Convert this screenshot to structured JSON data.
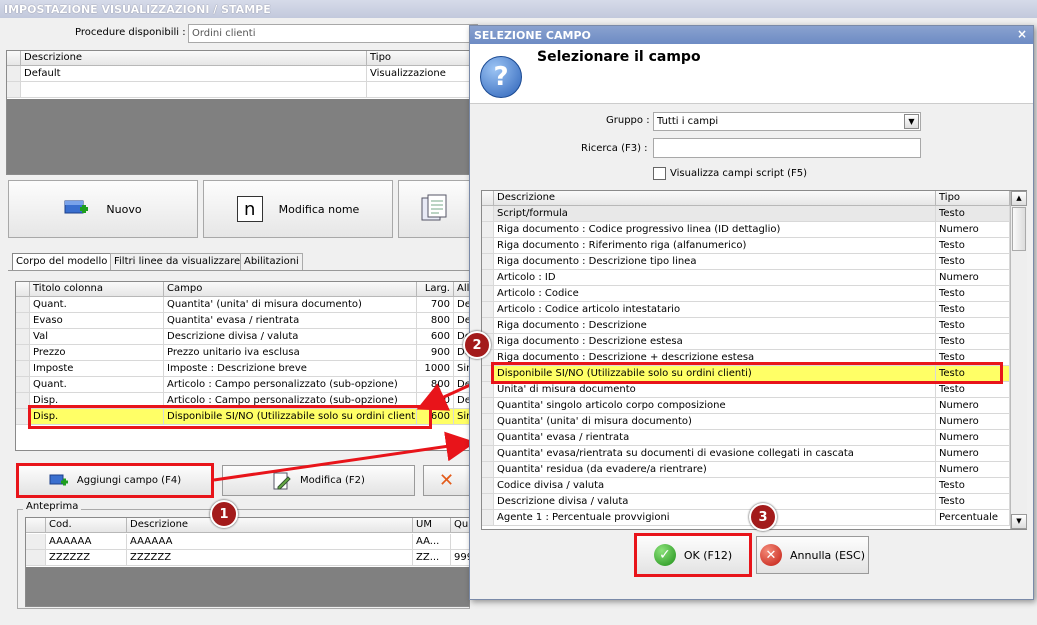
{
  "main": {
    "title": "IMPOSTAZIONE VISUALIZZAZIONI / STAMPE",
    "procedure_label": "Procedure disponibili :",
    "procedure_value": "Ordini clienti",
    "procedures_table": {
      "headers": [
        "Descrizione",
        "Tipo"
      ],
      "rows": [
        [
          "Default",
          "Visualizzazione"
        ]
      ]
    },
    "buttons": {
      "nuovo": "Nuovo",
      "modifica_nome": "Modifica nome",
      "n_glyph": "n"
    },
    "tabs": [
      "Corpo del modello",
      "Filtri linee da visualizzare",
      "Abilitazioni"
    ],
    "columns_table": {
      "headers": [
        "Titolo colonna",
        "Campo",
        "Larg.",
        "All"
      ],
      "rows": [
        [
          "Quant.",
          "Quantita' (unita' di misura documento)",
          "700",
          "De"
        ],
        [
          "Evaso",
          "Quantita' evasa / rientrata",
          "800",
          "De"
        ],
        [
          "Val",
          "Descrizione divisa / valuta",
          "600",
          "De"
        ],
        [
          "Prezzo",
          "Prezzo unitario iva esclusa",
          "900",
          "De"
        ],
        [
          "Imposte",
          "Imposte : Descrizione breve",
          "1000",
          "Sin"
        ],
        [
          "Quant.",
          "Articolo : Campo personalizzato (sub-opzione)",
          "800",
          "De"
        ],
        [
          "Disp.",
          "Articolo : Campo personalizzato (sub-opzione)",
          "800",
          "De"
        ],
        [
          "Disp.",
          "Disponibile SI/NO (Utilizzabile solo su ordini clienti)",
          "600",
          "Sin"
        ]
      ]
    },
    "actions": {
      "aggiungi": "Aggiungi campo (F4)",
      "modifica": "Modifica (F2)"
    },
    "anteprima": {
      "label": "Anteprima",
      "headers": [
        "Cod.",
        "Descrizione",
        "UM",
        "Qu"
      ],
      "rows": [
        [
          "AAAAAA",
          "AAAAAA",
          "AA...",
          ""
        ],
        [
          "ZZZZZZ",
          "ZZZZZZ",
          "ZZ...",
          "999"
        ]
      ]
    }
  },
  "dialog": {
    "title": "SELEZIONE CAMPO",
    "close": "×",
    "heading": "Selezionare il campo",
    "gruppo_label": "Gruppo :",
    "gruppo_value": "Tutti i campi",
    "ricerca_label": "Ricerca (F3) :",
    "ricerca_value": "",
    "script_checkbox": "Visualizza campi script (F5)",
    "table": {
      "headers": [
        "Descrizione",
        "Tipo"
      ],
      "rows": [
        [
          "Script/formula",
          "Testo"
        ],
        [
          "Riga documento : Codice progressivo linea (ID dettaglio)",
          "Numero"
        ],
        [
          "Riga documento : Riferimento riga (alfanumerico)",
          "Testo"
        ],
        [
          "Riga documento : Descrizione tipo linea",
          "Testo"
        ],
        [
          "Articolo : ID",
          "Numero"
        ],
        [
          "Articolo : Codice",
          "Testo"
        ],
        [
          "Articolo : Codice articolo intestatario",
          "Testo"
        ],
        [
          "Riga documento : Descrizione",
          "Testo"
        ],
        [
          "Riga documento : Descrizione estesa",
          "Testo"
        ],
        [
          "Riga documento : Descrizione + descrizione estesa",
          "Testo"
        ],
        [
          "Disponibile SI/NO (Utilizzabile solo su ordini clienti)",
          "Testo"
        ],
        [
          "Unita' di misura documento",
          "Testo"
        ],
        [
          "Quantita' singolo articolo corpo composizione",
          "Numero"
        ],
        [
          "Quantita' (unita' di misura documento)",
          "Numero"
        ],
        [
          "Quantita' evasa / rientrata",
          "Numero"
        ],
        [
          "Quantita' evasa/rientrata su documenti di evasione collegati in cascata",
          "Numero"
        ],
        [
          "Quantita' residua (da evadere/a rientrare)",
          "Numero"
        ],
        [
          "Codice divisa / valuta",
          "Testo"
        ],
        [
          "Descrizione divisa / valuta",
          "Testo"
        ],
        [
          "Agente 1 : Percentuale provvigioni",
          "Percentuale"
        ]
      ]
    },
    "ok": "OK (F12)",
    "annulla": "Annulla (ESC)"
  },
  "annotations": {
    "badge1": "1",
    "badge2": "2",
    "badge3": "3"
  },
  "colors": {
    "highlight": "#ffff66",
    "annotation_red": "#e8141a",
    "selected_row": "#ffff66"
  }
}
